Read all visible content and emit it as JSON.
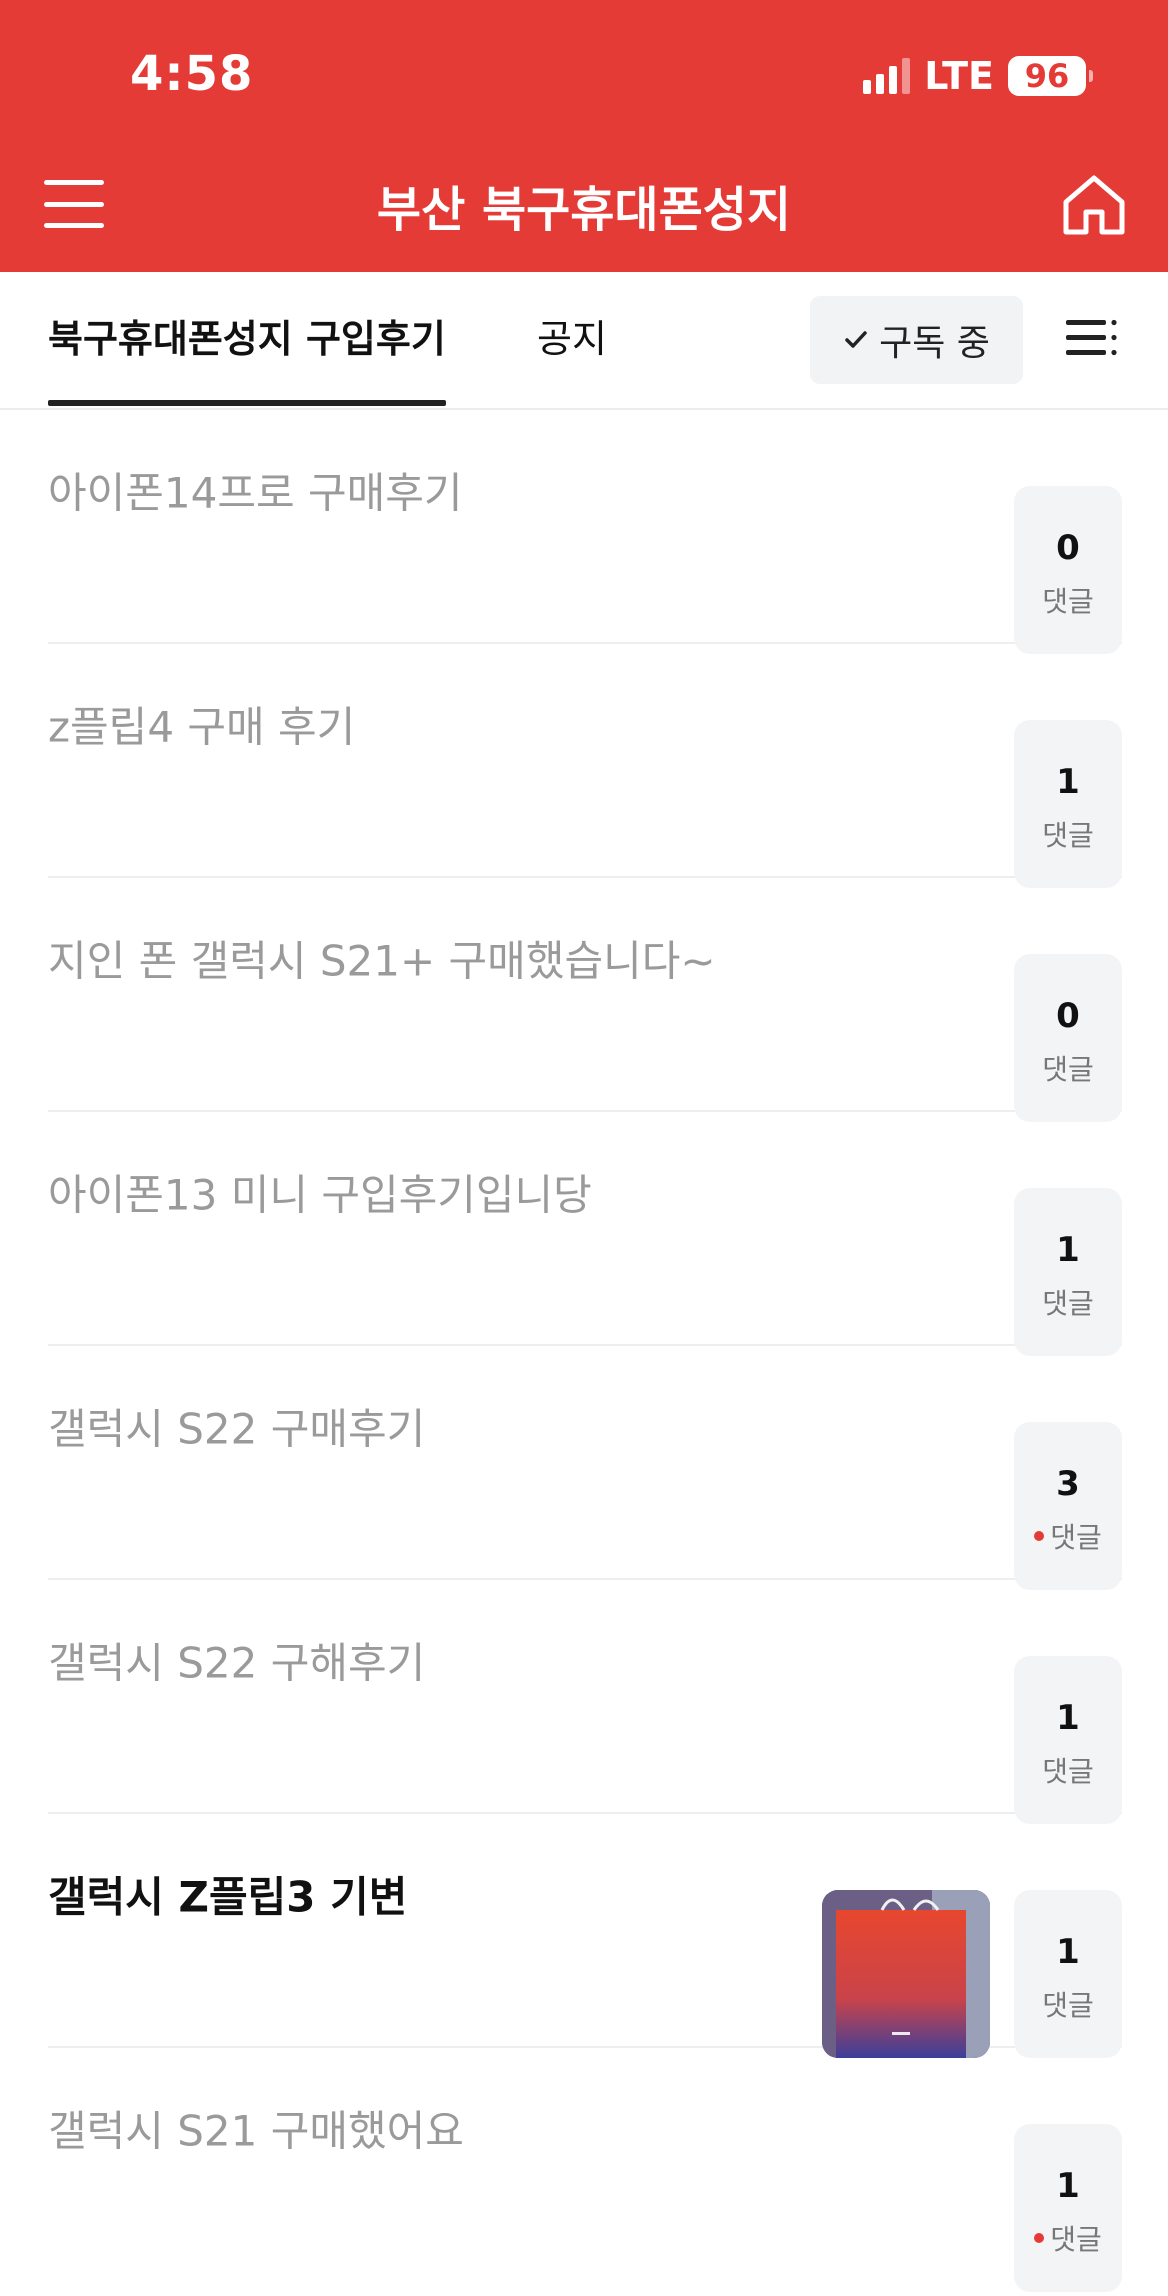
{
  "status_bar": {
    "time": "4:58",
    "network": "LTE",
    "battery": "96"
  },
  "header": {
    "title": "부산 북구휴대폰성지"
  },
  "tabs": [
    {
      "label": "북구휴대폰성지 구입후기",
      "active": true
    },
    {
      "label": "공지",
      "active": false
    }
  ],
  "subscribe_label": "구독 중",
  "posts": [
    {
      "title": "아이폰14프로 구매후기",
      "comments": "0",
      "comment_label": "댓글",
      "new_comment": false,
      "read": true
    },
    {
      "title": "z플립4 구매 후기",
      "comments": "1",
      "comment_label": "댓글",
      "new_comment": false,
      "read": true
    },
    {
      "title": "지인 폰 갤럭시 S21+ 구매했습니다~",
      "comments": "0",
      "comment_label": "댓글",
      "new_comment": false,
      "read": true
    },
    {
      "title": "아이폰13 미니 구입후기입니당",
      "comments": "1",
      "comment_label": "댓글",
      "new_comment": false,
      "read": true
    },
    {
      "title": "갤럭시 S22 구매후기",
      "comments": "3",
      "comment_label": "댓글",
      "new_comment": true,
      "read": true
    },
    {
      "title": "갤럭시 S22 구해후기",
      "comments": "1",
      "comment_label": "댓글",
      "new_comment": false,
      "read": true
    },
    {
      "title": "갤럭시 Z플립3 기변",
      "comments": "1",
      "comment_label": "댓글",
      "new_comment": false,
      "read": false,
      "has_thumbnail": true
    },
    {
      "title": "갤럭시 S21 구매했어요",
      "comments": "1",
      "comment_label": "댓글",
      "new_comment": true,
      "read": true
    }
  ],
  "colors": {
    "brand": "#e53b37",
    "read_title": "#9a9a9a",
    "unread_title": "#111111"
  }
}
